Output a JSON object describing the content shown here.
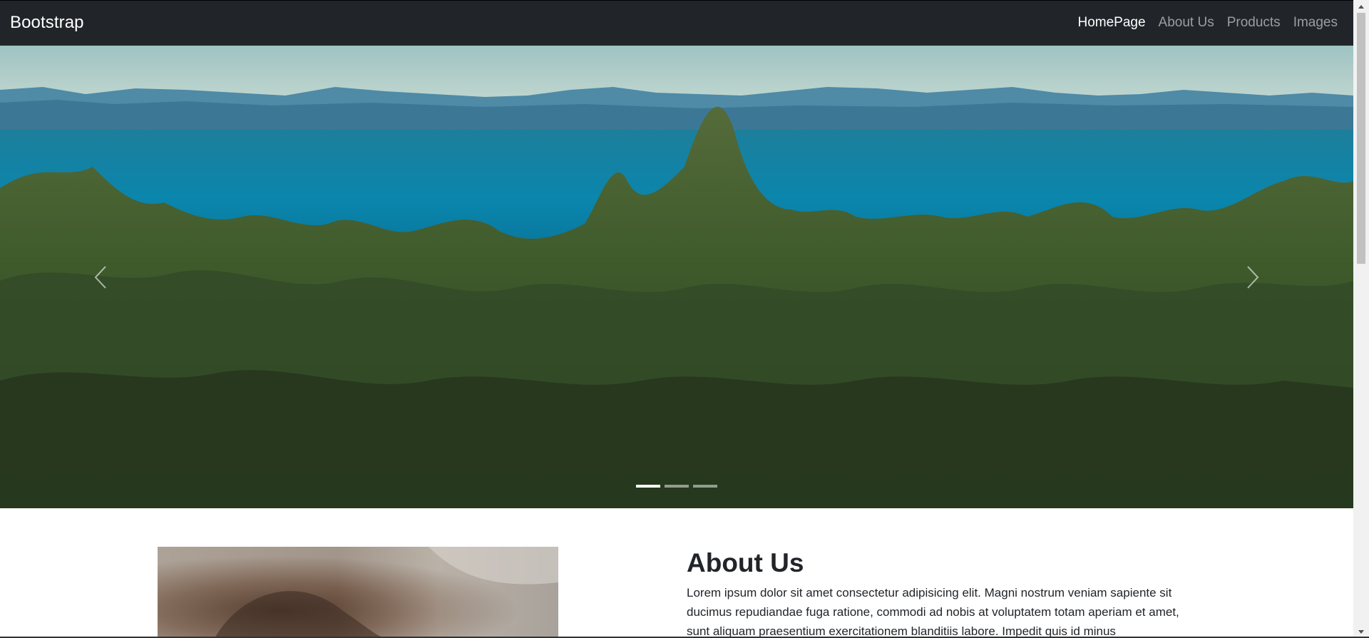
{
  "navbar": {
    "brand": "Bootstrap",
    "links": [
      {
        "label": "HomePage",
        "active": true
      },
      {
        "label": "About Us",
        "active": false
      },
      {
        "label": "Products",
        "active": false
      },
      {
        "label": "Images",
        "active": false
      }
    ]
  },
  "carousel": {
    "image_subject": "coastal forest with sea and distant mountains",
    "prev_icon": "chevron-left-icon",
    "next_icon": "chevron-right-icon",
    "slide_count": 3,
    "active_slide": 1
  },
  "about": {
    "title": "About Us",
    "body": "Lorem ipsum dolor sit amet consectetur adipisicing elit. Magni nostrum veniam sapiente sit ducimus repudiandae fuga ratione, commodi ad nobis at voluptatem totam aperiam et amet, sunt aliquam praesentium exercitationem blanditiis labore. Impedit quis id minus",
    "image_subject": "close-up of animal fur"
  },
  "colors": {
    "navbar_bg": "#212529",
    "nav_active": "#ffffff",
    "nav_inactive": "rgba(255,255,255,0.55)",
    "text": "#212529"
  }
}
